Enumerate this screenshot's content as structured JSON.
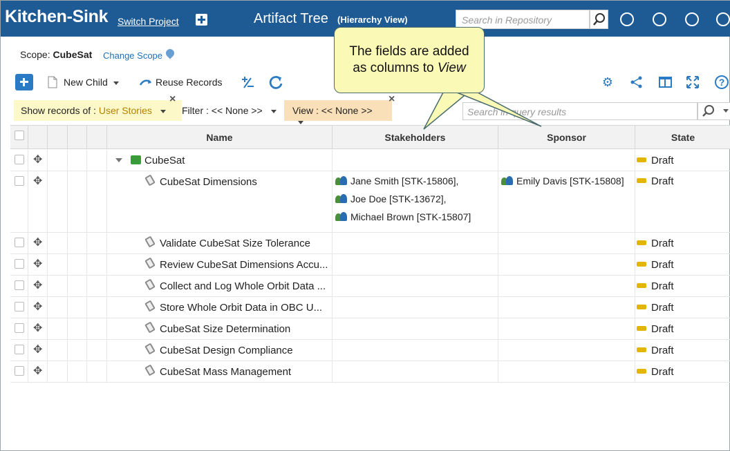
{
  "header": {
    "brand": "Kitchen-Sink",
    "switch_project": "Switch Project",
    "title": "Artifact Tree",
    "subtitle": "(Hierarchy View)",
    "search_placeholder": "Search in Repository"
  },
  "scope": {
    "label": "Scope:",
    "value": "CubeSat",
    "change": "Change Scope"
  },
  "toolbar": {
    "new_child": "New Child",
    "reuse_records": "Reuse Records"
  },
  "filters": {
    "records_label": "Show records of :",
    "records_value": "User Stories",
    "filter_label": "Filter : << None >>",
    "view_label": "View : << None >>",
    "query_placeholder": "Search in query results"
  },
  "callout": {
    "line1": "The fields are added",
    "line2_prefix": "as columns to ",
    "line2_em": "View"
  },
  "grid": {
    "columns": [
      "Name",
      "Stakeholders",
      "Sponsor",
      "State"
    ],
    "rows": [
      {
        "name": "CubeSat",
        "state": "Draft"
      },
      {
        "name": "CubeSat Dimensions",
        "state": "Draft",
        "stakeholders": [
          "Jane Smith [STK-15806],",
          "Joe Doe [STK-13672],",
          "Michael Brown [STK-15807]"
        ],
        "sponsor": "Emily Davis [STK-15808]"
      },
      {
        "name": "Validate CubeSat Size Tolerance",
        "state": "Draft"
      },
      {
        "name": "Review CubeSat Dimensions Accu...",
        "state": "Draft"
      },
      {
        "name": "Collect and Log Whole Orbit Data ...",
        "state": "Draft"
      },
      {
        "name": "Store Whole Orbit Data in OBC U...",
        "state": "Draft"
      },
      {
        "name": "CubeSat Size Determination",
        "state": "Draft"
      },
      {
        "name": "CubeSat Design Compliance",
        "state": "Draft"
      },
      {
        "name": "CubeSat Mass Management",
        "state": "Draft"
      }
    ]
  }
}
